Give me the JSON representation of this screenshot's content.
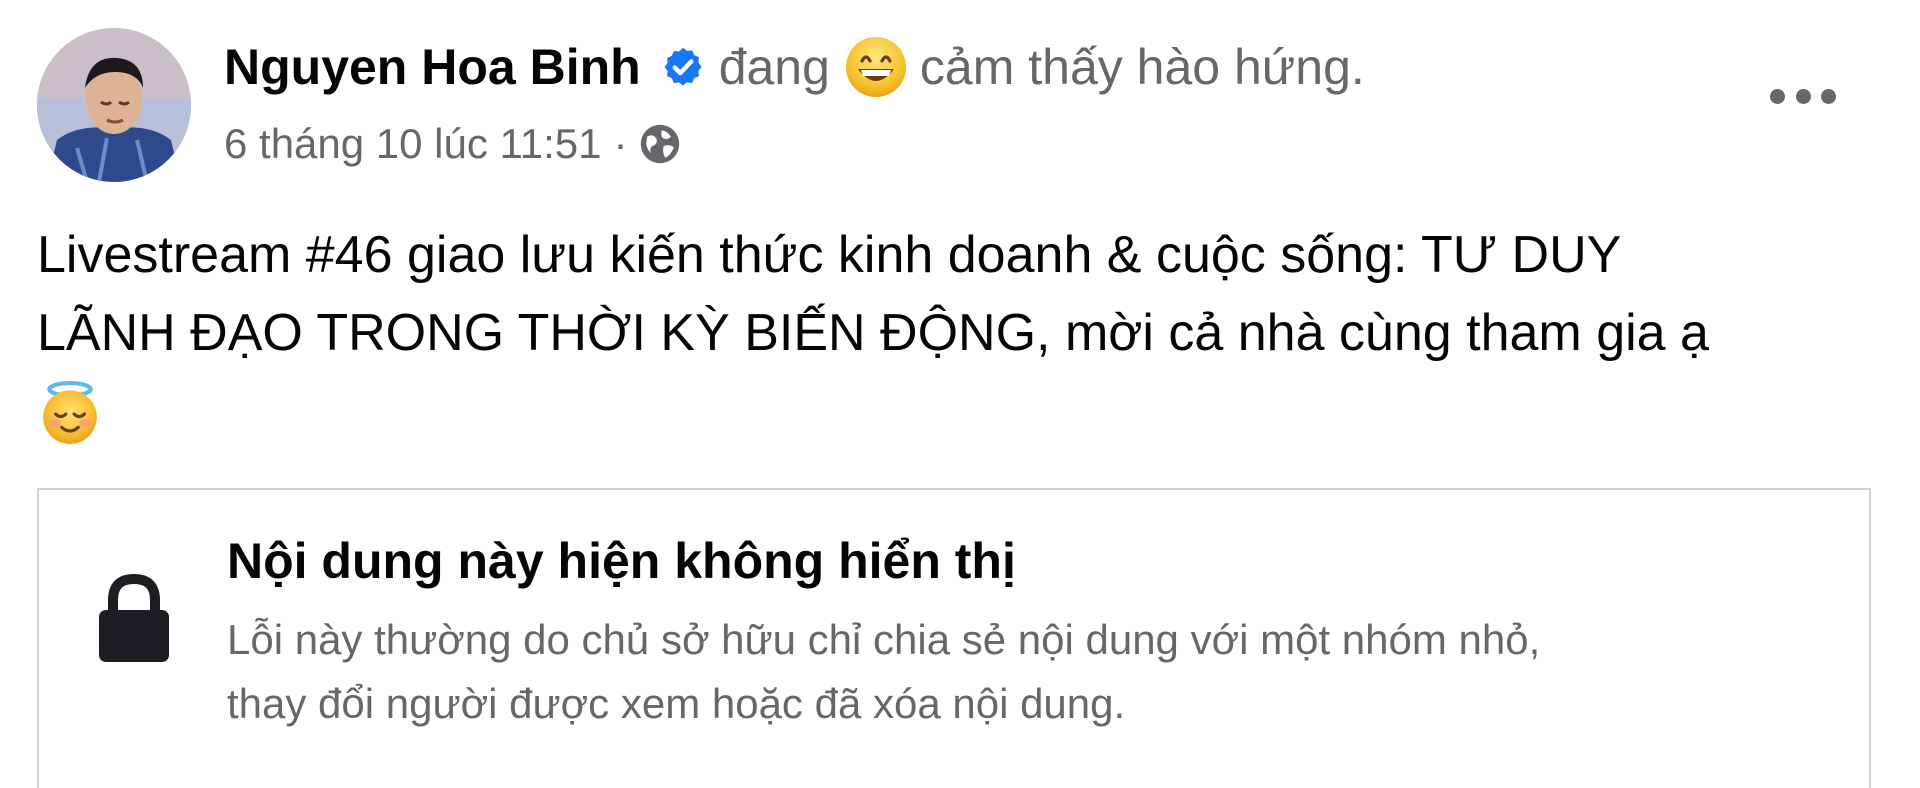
{
  "post": {
    "author": "Nguyen Hoa Binh",
    "feeling_prefix": "đang",
    "feeling_emoji": "grinning-face-emoji",
    "feeling_text": "cảm thấy hào hứng.",
    "timestamp": "6 tháng 10 lúc 11:51",
    "separator": "·",
    "audience_icon": "globe-icon",
    "more_icon": "more-options-icon",
    "text_lines": [
      "Livestream #46 giao lưu kiến thức kinh doanh & cuộc sống: TƯ DUY",
      "LÃNH ĐẠO TRONG THỜI KỲ BIẾN ĐỘNG, mời cả nhà cùng tham gia ạ"
    ],
    "trailing_emoji": "smiling-face-with-halo-emoji"
  },
  "unavailable_notice": {
    "icon": "lock-icon",
    "title": "Nội dung này hiện không hiển thị",
    "description_lines": [
      "Lỗi này thường do chủ sở hữu chỉ chia sẻ nội dung với một nhóm nhỏ,",
      "thay đổi người được xem hoặc đã xóa nội dung."
    ]
  },
  "colors": {
    "primary_text": "#050505",
    "secondary_text": "#65676b",
    "verified_blue": "#1877f2",
    "border": "#ced0d4"
  }
}
